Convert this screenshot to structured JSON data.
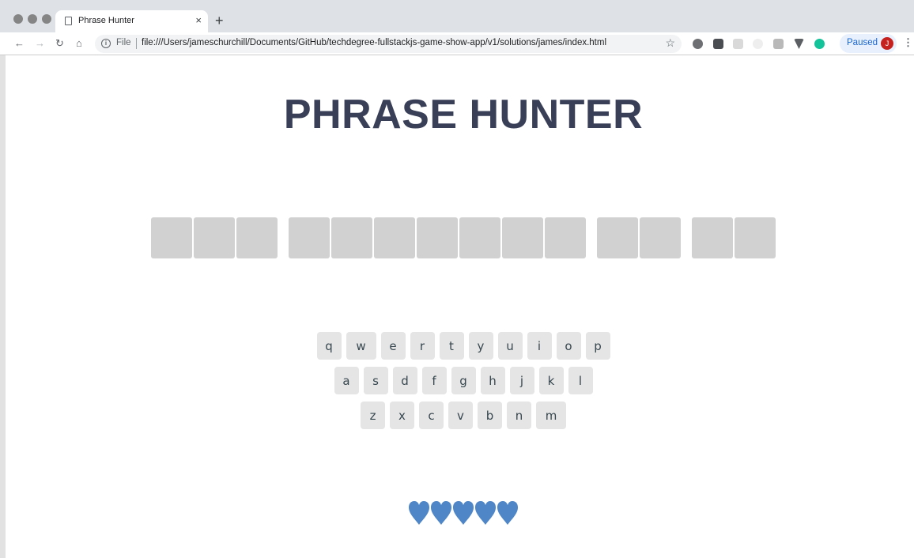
{
  "browser": {
    "tab_title": "Phrase Hunter",
    "tab_close": "×",
    "new_tab": "+",
    "omnibox_label": "File",
    "url": "file:///Users/jameschurchill/Documents/GitHub/techdegree-fullstackjs-game-show-app/v1/solutions/james/index.html",
    "profile_status": "Paused",
    "avatar_initial": "J"
  },
  "game": {
    "title": "PHRASE HUNTER",
    "phrase_words": [
      3,
      7,
      2,
      2
    ],
    "keyboard_rows": [
      [
        "q",
        "w",
        "e",
        "r",
        "t",
        "y",
        "u",
        "i",
        "o",
        "p"
      ],
      [
        "a",
        "s",
        "d",
        "f",
        "g",
        "h",
        "j",
        "k",
        "l"
      ],
      [
        "z",
        "x",
        "c",
        "v",
        "b",
        "n",
        "m"
      ]
    ],
    "lives": 5,
    "heart_color": "#4e86c7"
  }
}
